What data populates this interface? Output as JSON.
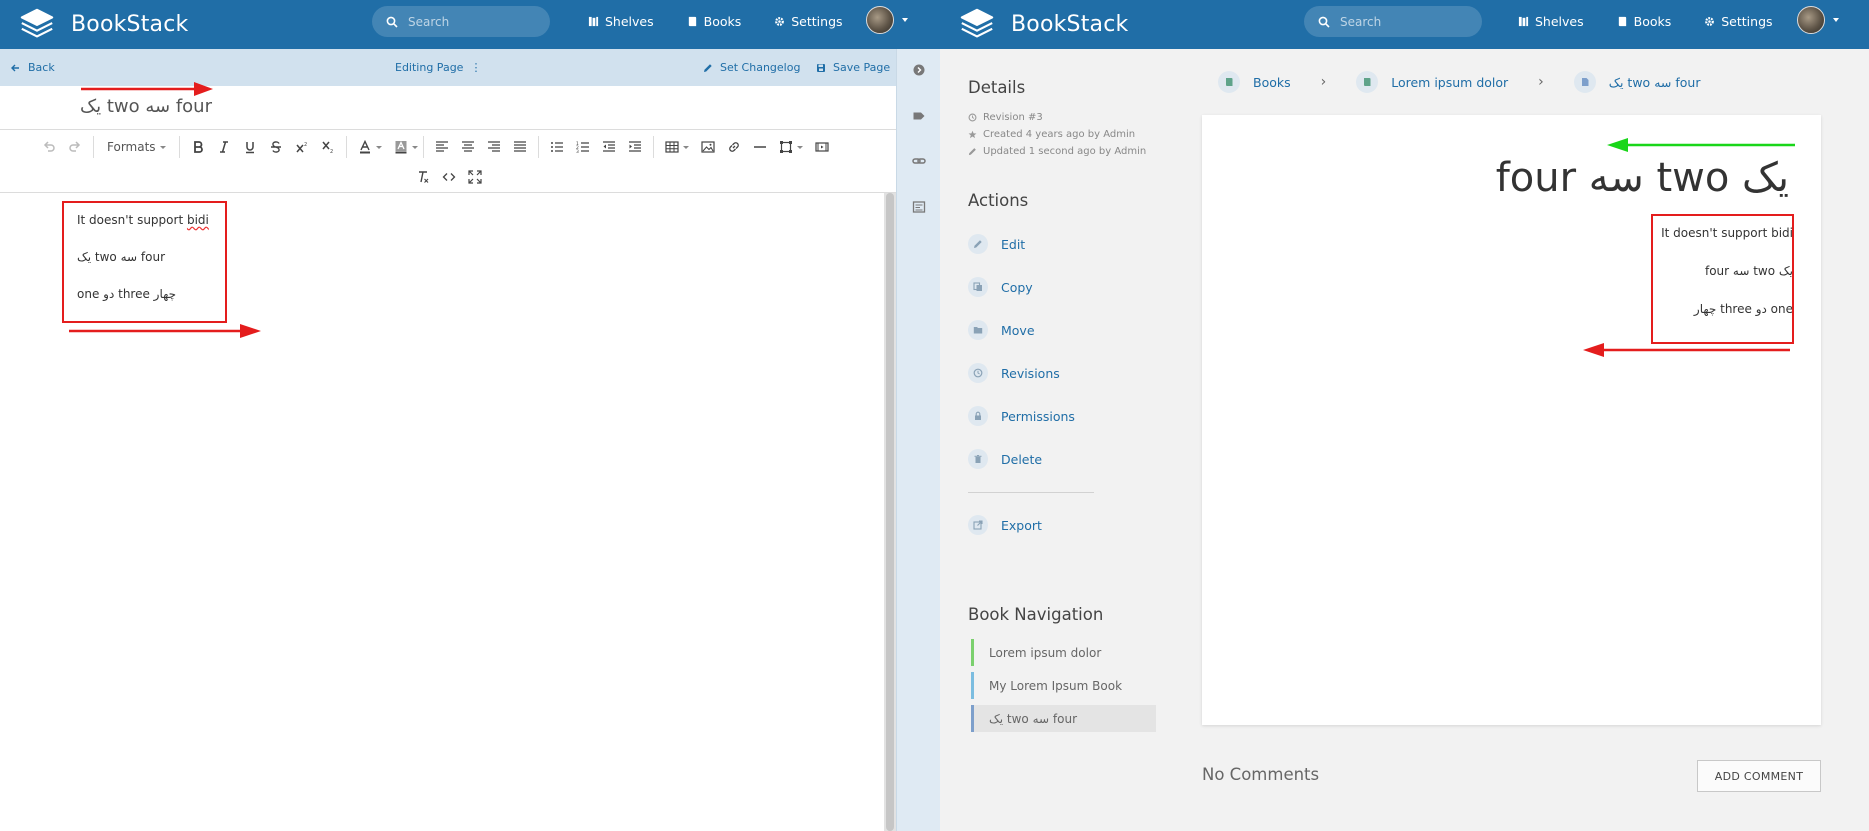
{
  "app": {
    "brand": "BookStack",
    "search_placeholder": "Search",
    "nav": {
      "shelves": "Shelves",
      "books": "Books",
      "settings": "Settings"
    }
  },
  "editor": {
    "back_label": "Back",
    "editing_label": "Editing Page",
    "editing_menu": "⋮",
    "changelog_label": "Set Changelog",
    "save_label": "Save Page",
    "title_value": "یک two سه four",
    "toolbar": {
      "formats_label": "Formats"
    },
    "paragraphs": [
      "It doesn't support bidi",
      "یک two سه four",
      "one دو three چهار"
    ]
  },
  "view": {
    "details_heading": "Details",
    "meta": {
      "revision": "Revision #3",
      "created": "Created 4 years ago by Admin",
      "updated": "Updated 1 second ago by Admin"
    },
    "actions_heading": "Actions",
    "actions": {
      "edit": "Edit",
      "copy": "Copy",
      "move": "Move",
      "revisions": "Revisions",
      "permissions": "Permissions",
      "delete": "Delete",
      "export": "Export"
    },
    "book_nav_heading": "Book Navigation",
    "book_nav": {
      "item1": "Lorem ipsum dolor",
      "item2": "My Lorem Ipsum Book",
      "item3": "یک two سه four"
    },
    "breadcrumbs": {
      "books": "Books",
      "book": "Lorem ipsum dolor",
      "page": "یک two سه four"
    },
    "content": {
      "title": "یک two سه four",
      "paragraphs": [
        "It doesn't support bidi",
        "یک two سه four",
        "one دو three چهار"
      ]
    },
    "no_comments": "No Comments",
    "add_comment_label": "ADD COMMENT"
  },
  "colors": {
    "header": "#206ea7",
    "edit_bar": "#d1e1ee",
    "annotation_red": "#e41d1d",
    "annotation_green": "#19d619"
  }
}
